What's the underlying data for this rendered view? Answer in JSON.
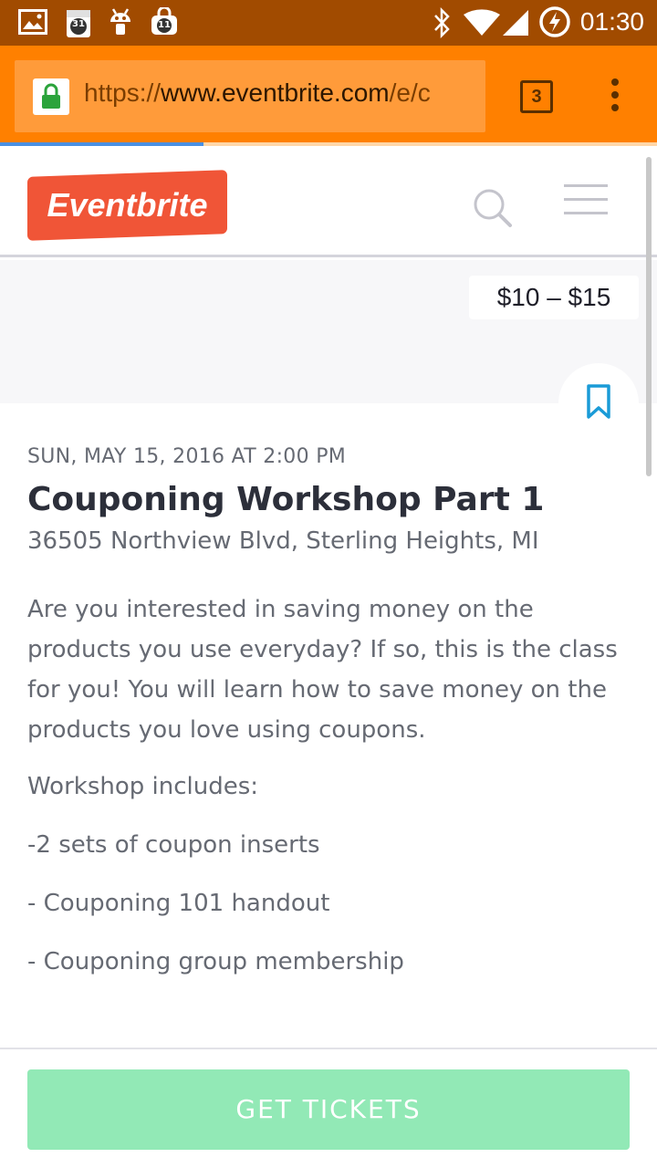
{
  "status_bar": {
    "time": "01:30",
    "calendar_badge": "31",
    "store_badge": "11"
  },
  "browser": {
    "url_scheme": "https://",
    "url_domain": "www.eventbrite.com",
    "url_path": "/e/c",
    "tab_count": "3",
    "load_progress": 0.31
  },
  "site": {
    "logo_text": "Eventbrite"
  },
  "event": {
    "price": "$10 – $15",
    "date": "SUN, MAY 15, 2016 AT 2:00 PM",
    "title": "Couponing Workshop Part 1",
    "address": "36505 Northview Blvd, Sterling Heights, MI",
    "description": "Are you interested in saving money on the products you use everyday? If so, this is the class for you! You will learn how to save money on the products you love using coupons.",
    "includes_label": "Workshop includes:",
    "includes": [
      "-2 sets of coupon inserts",
      "- Couponing 101 handout",
      "- Couponing group membership"
    ]
  },
  "cta": {
    "label": "GET TICKETS"
  },
  "colors": {
    "status_bar": "#a14b00",
    "toolbar": "#ff8000",
    "brand": "#f05537",
    "accent_blue": "#1a9bd7",
    "cta": "#92e9b6"
  }
}
